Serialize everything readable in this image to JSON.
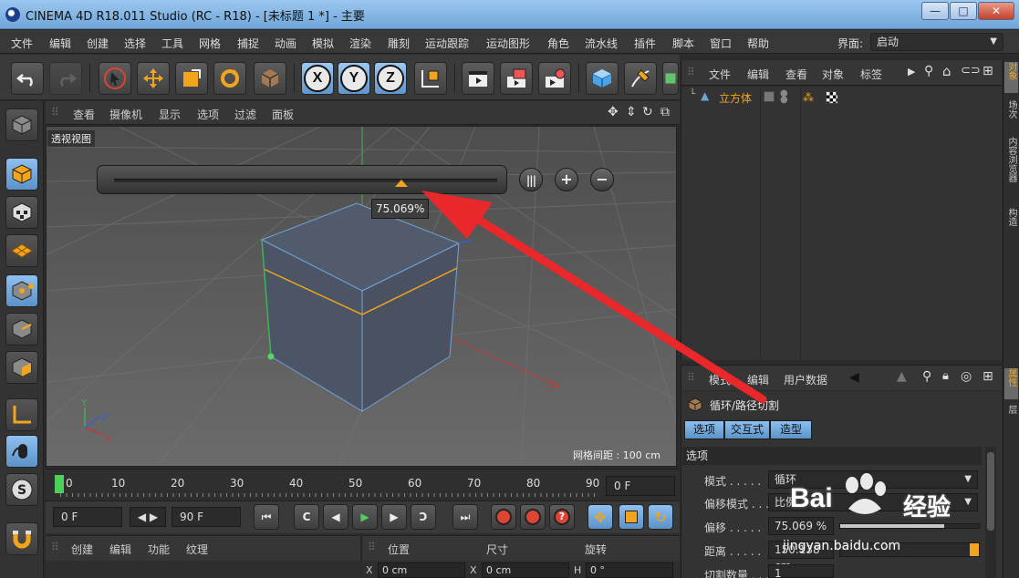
{
  "app": {
    "title": "CINEMA 4D R18.011 Studio (RC - R18) - [未标题 1 *] - 主要",
    "window_controls": [
      "minimize",
      "maximize",
      "close"
    ]
  },
  "menubar": {
    "items": [
      "文件",
      "编辑",
      "创建",
      "选择",
      "工具",
      "网格",
      "捕捉",
      "动画",
      "模拟",
      "渲染",
      "雕刻",
      "运动跟踪",
      "运动图形",
      "角色",
      "流水线",
      "插件",
      "脚本",
      "窗口",
      "帮助"
    ],
    "layout_label": "界面:",
    "layout_value": "启动"
  },
  "viewport": {
    "menu": [
      "查看",
      "摄像机",
      "显示",
      "选项",
      "过滤",
      "面板"
    ],
    "label": "透视视图",
    "grid_spacing": "网格间距 : 100 cm",
    "axis_labels": {
      "y": "Y",
      "z": "Z",
      "x": "X"
    },
    "slider": {
      "value_percent": 75.069,
      "tooltip": "75.069%",
      "buttons": [
        "pause",
        "+",
        "−"
      ]
    }
  },
  "timeline": {
    "ticks": [
      "0",
      "10",
      "20",
      "30",
      "40",
      "50",
      "60",
      "70",
      "80",
      "90"
    ],
    "current_frame_field": "0 F"
  },
  "playback": {
    "start_field": "0 F",
    "end_field": "90 F"
  },
  "materials_bar": {
    "items": [
      "创建",
      "编辑",
      "功能",
      "纹理"
    ]
  },
  "coords_bar": {
    "headers": [
      "位置",
      "尺寸",
      "旋转"
    ],
    "row": [
      {
        "axis": "X",
        "value": "0 cm"
      },
      {
        "axis": "X",
        "value": "0 cm"
      },
      {
        "axis": "H",
        "value": "0 °"
      }
    ]
  },
  "object_manager": {
    "menu": [
      "文件",
      "编辑",
      "查看",
      "对象",
      "标签"
    ],
    "objects": [
      {
        "name": "立方体"
      }
    ]
  },
  "attribute_manager": {
    "menu": [
      "模式",
      "编辑",
      "用户数据"
    ],
    "tool_name": "循环/路径切割",
    "tabs": [
      "选项",
      "交互式",
      "造型"
    ],
    "section": "选项",
    "fields": [
      {
        "label": "模式 . . . . .",
        "value": "循环"
      },
      {
        "label": "偏移模式 . . .",
        "value": "比例"
      },
      {
        "label": "偏移 . . . . .",
        "value": "75.069 %"
      },
      {
        "label": "距离 . . . . .",
        "value": "150.138 cm"
      },
      {
        "label": "切割数量 . . .",
        "value": "1"
      }
    ]
  },
  "right_tabs": [
    "对象",
    "场次",
    "内容浏览器",
    "构造",
    "属性",
    "层"
  ],
  "watermark": {
    "logo": "Bai",
    "word": "经验",
    "url": "jingyan.baidu.com"
  },
  "colors": {
    "accent_orange": "#f2a51c",
    "selection_blue": "#6ea3d8",
    "annotation_red": "#e8282b"
  }
}
